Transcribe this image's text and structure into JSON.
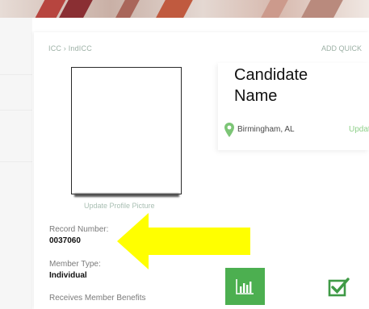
{
  "breadcrumb": "ICC › IndICC",
  "header": {
    "add_quick": "ADD QUICK"
  },
  "profile": {
    "update_picture": "Update Profile Picture",
    "candidate_name": "Candidate Name",
    "location": "Birmingham, AL",
    "location_update": "Update"
  },
  "fields": {
    "record_number_label": "Record Number:",
    "record_number_value": "0037060",
    "member_type_label": "Member Type:",
    "member_type_value": "Individual",
    "benefits_label": "Receives Member Benefits"
  },
  "icons": {
    "pin": "map-pin-icon",
    "chart": "bar-chart-icon",
    "check": "checkbox-check-icon",
    "arrow": "yellow-arrow-annotation"
  },
  "colors": {
    "accent_green": "#4caf50",
    "arrow_yellow": "#ffff00",
    "link_green": "#8fd08a"
  }
}
